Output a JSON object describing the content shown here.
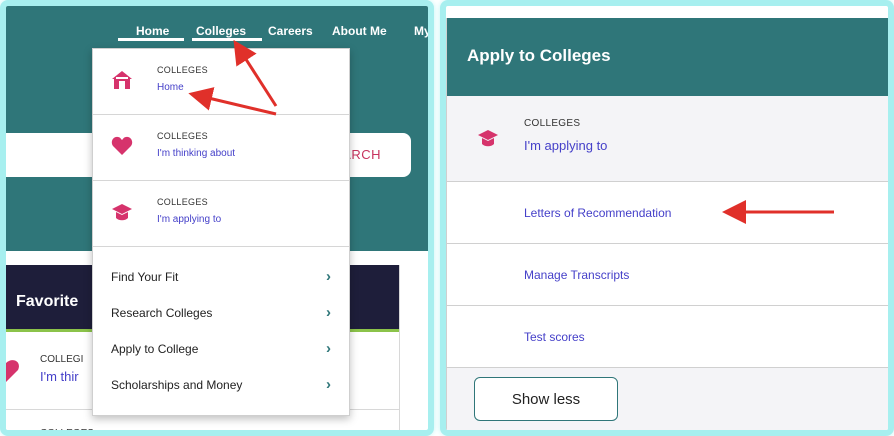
{
  "left": {
    "nav": {
      "home": "Home",
      "colleges": "Colleges",
      "careers": "Careers",
      "about": "About Me",
      "more": "My"
    },
    "search_label": "ARCH",
    "dropdown": {
      "items": [
        {
          "category": "COLLEGES",
          "link": "Home",
          "icon": "house-icon"
        },
        {
          "category": "COLLEGES",
          "link": "I'm thinking about",
          "icon": "heart-icon"
        },
        {
          "category": "COLLEGES",
          "link": "I'm applying to",
          "icon": "graduation-cap-icon"
        }
      ],
      "list": [
        {
          "label": "Find Your Fit",
          "icon": "chevron-right-icon"
        },
        {
          "label": "Research Colleges",
          "icon": "chevron-right-icon"
        },
        {
          "label": "Apply to College",
          "icon": "chevron-right-icon"
        },
        {
          "label": "Scholarships and Money",
          "icon": "chevron-right-icon"
        }
      ],
      "chevron": "›"
    },
    "favorites": {
      "title": "Favorite",
      "item_category": "COLLEGI",
      "item_link": "I'm thir",
      "item2_category": "COLLEGES"
    }
  },
  "right": {
    "title": "Apply to Colleges",
    "applying": {
      "category": "COLLEGES",
      "link": "I'm applying to"
    },
    "links": [
      "Letters of Recommendation",
      "Manage Transcripts",
      "Test scores"
    ],
    "show_less": "Show less"
  },
  "colors": {
    "teal": "#2f7679",
    "border_cyan": "#a7efef",
    "link_blue": "#4540c9",
    "pink": "#d6336c",
    "arrow_red": "#e0302a",
    "navy": "#1e1e3a"
  }
}
